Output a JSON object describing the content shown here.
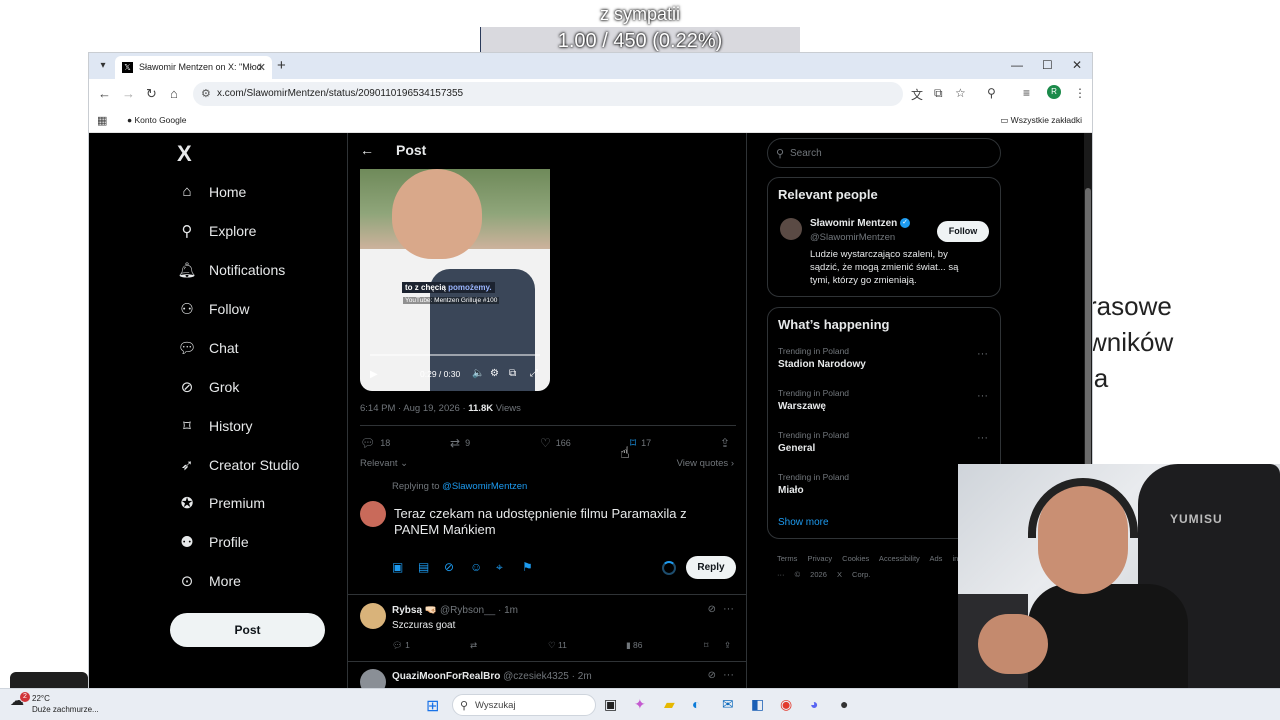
{
  "overlay": {
    "label": "z sympatii",
    "count": "1.00 / 450 (0.22%)",
    "progress_fraction": 0.0022
  },
  "background_text": {
    "line1": "rasowe",
    "line2": "wników",
    "line3": "ia"
  },
  "browser": {
    "tab_title": "Sławomir Mentzen on X: \"Młod",
    "url": "x.com/SlawomirMentzen/status/2090110196534157355",
    "bookmark_1": "Konto Google",
    "bookmarks_all": "Wszystkie zakładki",
    "profile_initial": "R"
  },
  "x": {
    "logo": "X",
    "nav": [
      {
        "label": "Home",
        "icon": "home-icon"
      },
      {
        "label": "Explore",
        "icon": "search-icon"
      },
      {
        "label": "Notifications",
        "icon": "bell-icon"
      },
      {
        "label": "Follow",
        "icon": "add-person-icon"
      },
      {
        "label": "Chat",
        "icon": "chat-icon"
      },
      {
        "label": "Grok",
        "icon": "grok-icon"
      },
      {
        "label": "History",
        "icon": "bookmark-icon"
      },
      {
        "label": "Creator Studio",
        "icon": "rocket-icon"
      },
      {
        "label": "Premium",
        "icon": "verified-icon"
      },
      {
        "label": "Profile",
        "icon": "person-icon"
      },
      {
        "label": "More",
        "icon": "more-circle-icon"
      }
    ],
    "post_button": "Post",
    "header_title": "Post",
    "video": {
      "caption_1": "to z chęcią",
      "caption_1b": "pomożemy.",
      "caption_2": "YouTube: Mentzen Grilluje #100",
      "time": "0:29 / 0:30"
    },
    "meta": {
      "time": "6:14 PM · Aug 19, 2026 · ",
      "views_count": "11.8K",
      "views_label": " Views"
    },
    "actions": {
      "replies": "18",
      "reposts": "9",
      "likes": "166",
      "bookmarks": "17"
    },
    "relevant": "Relevant",
    "view_quotes": "View quotes",
    "replying_to_prefix": "Replying to ",
    "replying_to_handle": "@SlawomirMentzen",
    "reply_draft": "Teraz czekam na udostępnienie filmu Paramaxila z PANEM Mańkiem",
    "reply_button": "Reply",
    "replies": [
      {
        "name": "Rybsą 🤜🏻",
        "handle": "@Rybson__ · 1m",
        "text": "Szczuras goat",
        "replies": "1",
        "reposts": "",
        "likes": "11",
        "views": "86"
      },
      {
        "name": "QuaziMoonForRealBro",
        "handle": "@czesiek4325 · 2m",
        "text": ""
      }
    ],
    "search_placeholder": "Search",
    "relevant_people": {
      "title": "Relevant people",
      "name": "Sławomir Mentzen",
      "handle": "@SlawomirMentzen",
      "bio": "Ludzie wystarczająco szaleni, by sądzić, że mogą zmienić świat... są tymi, którzy go zmieniają.",
      "follow": "Follow"
    },
    "happening": {
      "title": "What’s happening",
      "trends": [
        {
          "context": "Trending in Poland",
          "name": "Stadion Narodowy"
        },
        {
          "context": "Trending in Poland",
          "name": "Warszawę"
        },
        {
          "context": "Trending in Poland",
          "name": "General"
        },
        {
          "context": "Trending in Poland",
          "name": "Miało"
        }
      ],
      "show_more": "Show more"
    },
    "footer": "Terms Privacy Cookies Accessibility Ads info More ··· © 2026 X Corp."
  },
  "webcam": {
    "chair_brand": "YUMISU"
  },
  "taskbar": {
    "temp": "22°C",
    "weather": "Duże zachmurze...",
    "notif": "2",
    "search": "Wyszukaj"
  }
}
